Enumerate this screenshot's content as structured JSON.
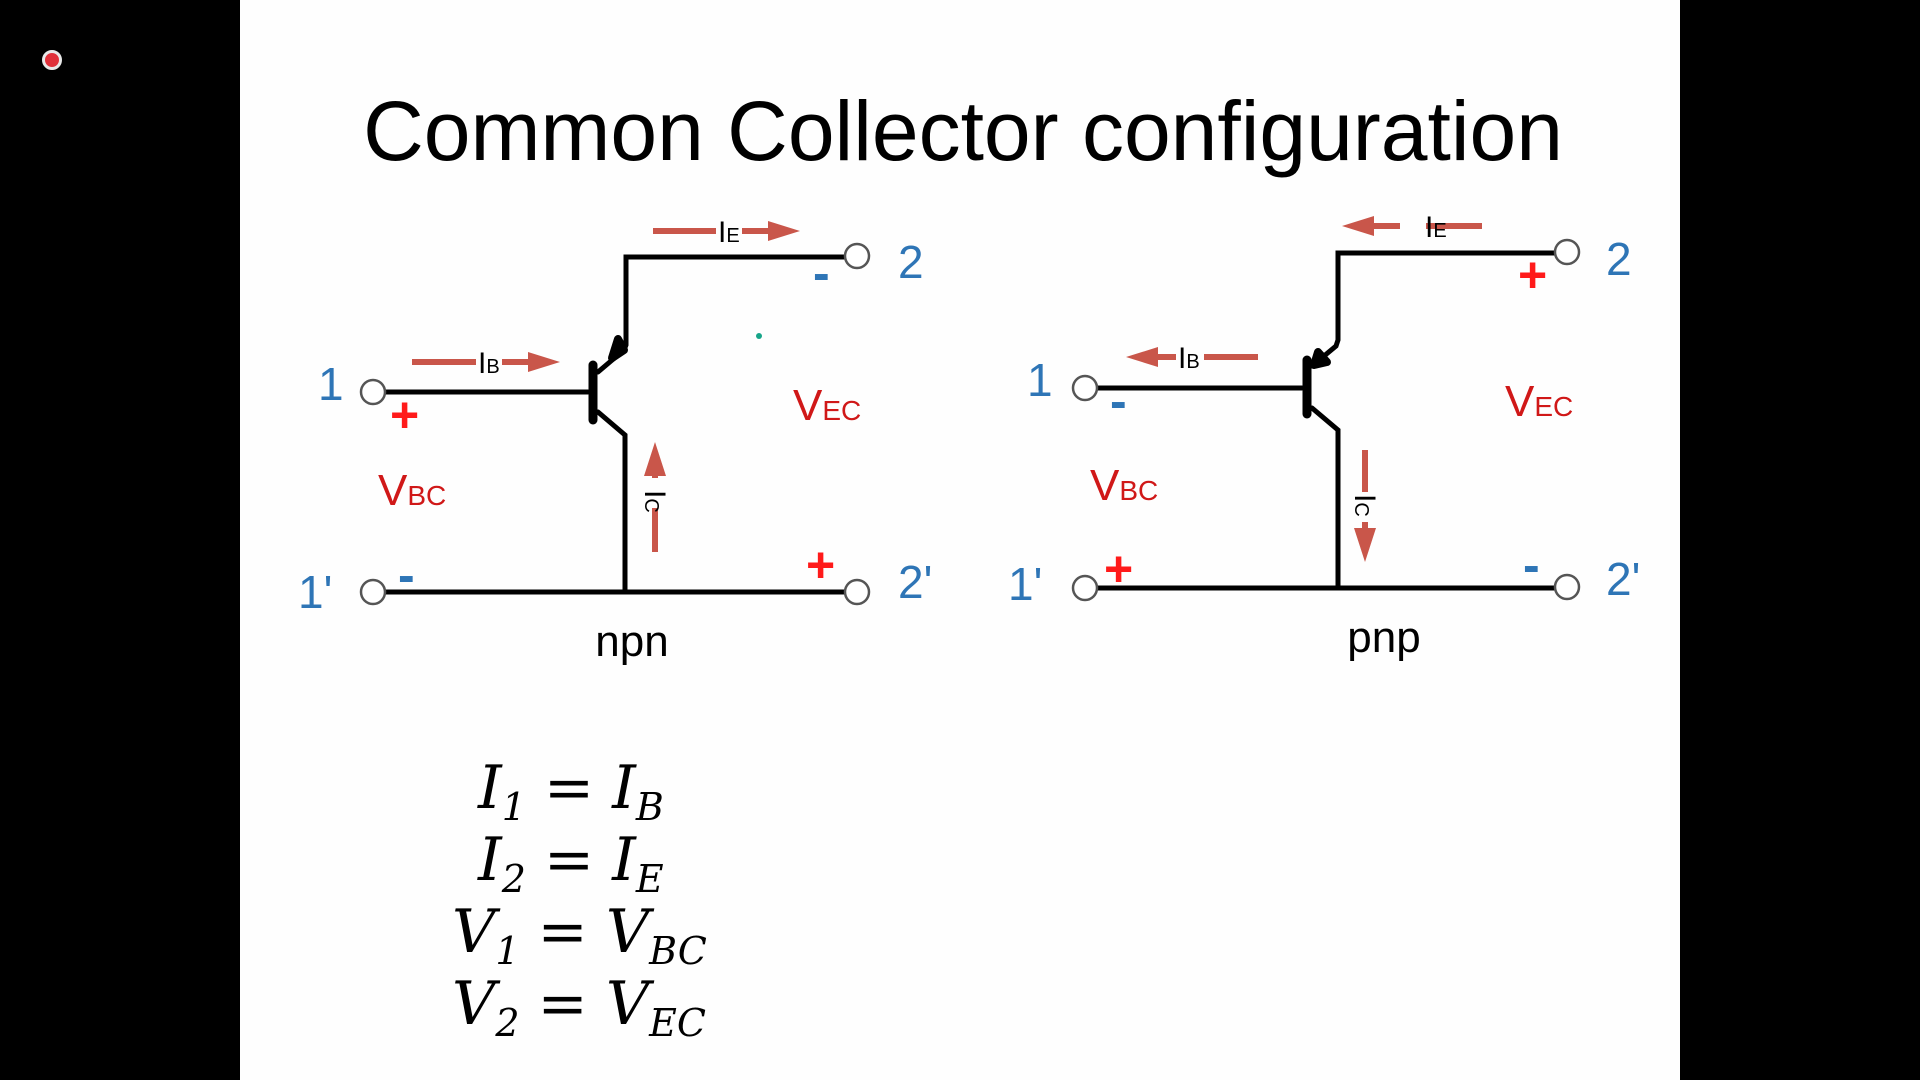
{
  "title": "Common Collector configuration",
  "npn": {
    "caption": "npn",
    "port_in": "1",
    "port_in_gnd": "1'",
    "port_out": "2",
    "port_out_gnd": "2'",
    "in_plus": "+",
    "in_minus": "-",
    "out_plus": "+",
    "out_minus": "-",
    "v_in": {
      "main": "V",
      "sub": "BC"
    },
    "v_out": {
      "main": "V",
      "sub": "EC"
    },
    "i_b": {
      "main": "I",
      "sub": "B"
    },
    "i_e": {
      "main": "I",
      "sub": "E"
    },
    "i_c": {
      "main": "I",
      "sub": "C"
    }
  },
  "pnp": {
    "caption": "pnp",
    "port_in": "1",
    "port_in_gnd": "1'",
    "port_out": "2",
    "port_out_gnd": "2'",
    "in_plus": "+",
    "in_minus": "-",
    "out_plus": "+",
    "out_minus": "-",
    "v_in": {
      "main": "V",
      "sub": "BC"
    },
    "v_out": {
      "main": "V",
      "sub": "EC"
    },
    "i_b": {
      "main": "I",
      "sub": "B"
    },
    "i_e": {
      "main": "I",
      "sub": "E"
    },
    "i_c": {
      "main": "I",
      "sub": "C"
    }
  },
  "equations": [
    {
      "lhs": "I",
      "lhs_sub": "1",
      "op": "=",
      "rhs": "I",
      "rhs_sub": "B"
    },
    {
      "lhs": "I",
      "lhs_sub": "2",
      "op": "=",
      "rhs": "I",
      "rhs_sub": "E"
    },
    {
      "lhs": "V",
      "lhs_sub": "1",
      "op": "=",
      "rhs": "V",
      "rhs_sub": "BC"
    },
    {
      "lhs": "V",
      "lhs_sub": "2",
      "op": "=",
      "rhs": "V",
      "rhs_sub": "EC"
    }
  ],
  "colors": {
    "label_blue": "#2e75b6",
    "voltage_red": "#d01818",
    "arrow": "#c9564a"
  }
}
